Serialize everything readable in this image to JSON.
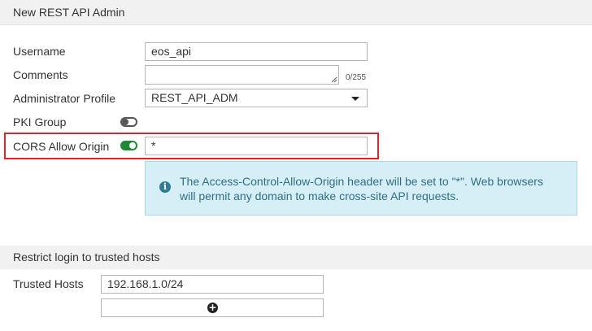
{
  "panel": {
    "title": "New REST API Admin"
  },
  "form": {
    "username": {
      "label": "Username",
      "value": "eos_api"
    },
    "comments": {
      "label": "Comments",
      "value": "",
      "counter": "0/255"
    },
    "admin_profile": {
      "label": "Administrator Profile",
      "value": "REST_API_ADM"
    },
    "pki_group": {
      "label": "PKI Group",
      "enabled": false
    },
    "cors": {
      "label": "CORS Allow Origin",
      "enabled": true,
      "value": "*"
    }
  },
  "info": {
    "icon": "info-circle-icon",
    "text_line1": "The Access-Control-Allow-Origin header will be set to \"*\". Web browsers",
    "text_line2": "will permit any domain to make cross-site API requests."
  },
  "trusted": {
    "section_title": "Restrict login to trusted hosts",
    "label": "Trusted Hosts",
    "hosts": [
      "192.168.1.0/24"
    ],
    "add_icon": "plus-circle-icon"
  },
  "colors": {
    "highlight": "#d7262c",
    "toggle_on": "#1f8a35",
    "info_bg": "#d6eef5",
    "info_text": "#2f6f86"
  }
}
